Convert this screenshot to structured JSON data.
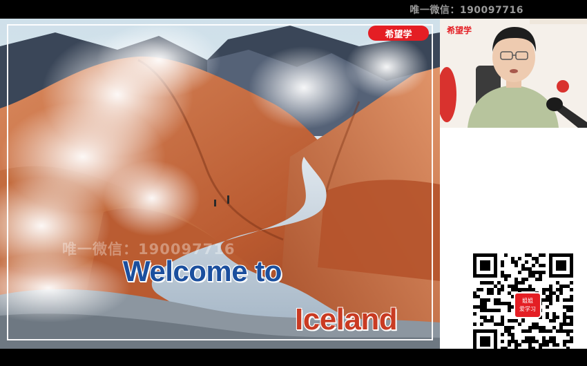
{
  "header": {
    "watermark": "唯一微信：190097716"
  },
  "slide": {
    "logo": "希望学",
    "watermark": "唯一微信：190097716",
    "title_line1": "Welcome to",
    "title_line2": "Iceland"
  },
  "webcam": {
    "logo": "希望学"
  },
  "qr": {
    "badge_line1": "姐姐",
    "badge_line2": "爱学习"
  }
}
